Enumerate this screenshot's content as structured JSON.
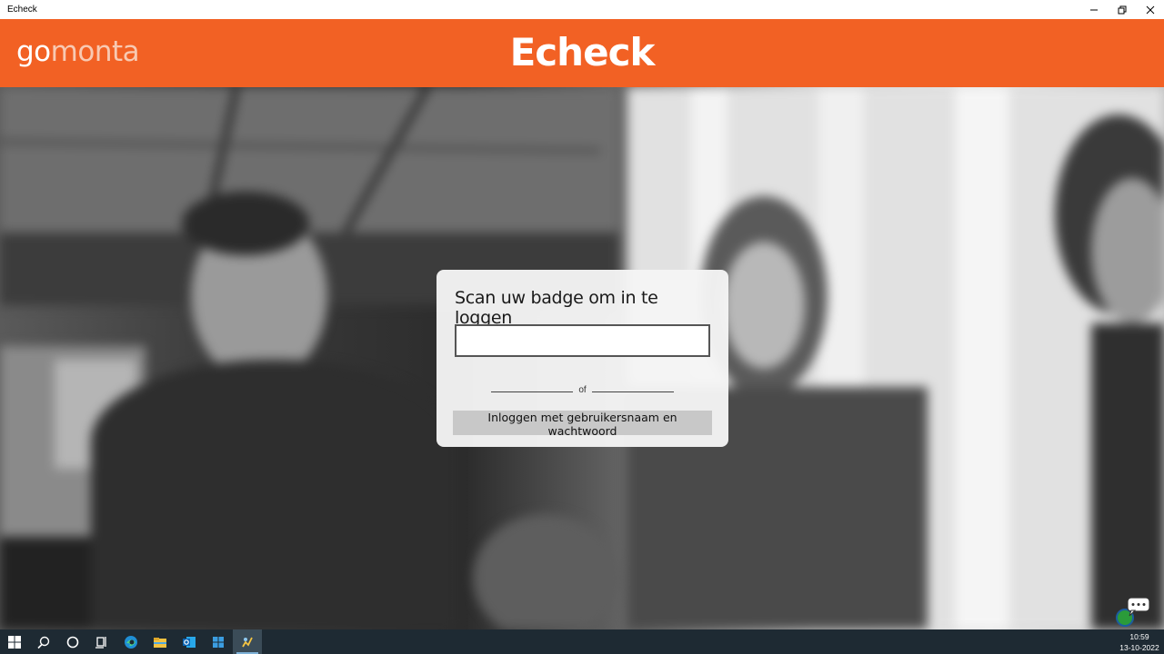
{
  "window": {
    "title": "Echeck"
  },
  "header": {
    "logo_go": "go",
    "logo_monta": "monta",
    "app_title": "Echeck",
    "bg_color": "#f26124"
  },
  "login": {
    "title": "Scan uw badge om in te loggen",
    "badge_value": "",
    "divider_text": "of",
    "username_button": "Inloggen met gebruikersnaam en wachtwoord"
  },
  "taskbar": {
    "items": [
      "start-icon",
      "search-icon",
      "cortana-icon",
      "task-view-icon",
      "edge-icon",
      "file-explorer-icon",
      "outlook-icon",
      "store-icon",
      "echeck-app-icon"
    ],
    "time": "10:59",
    "date": "13-10-2022"
  }
}
